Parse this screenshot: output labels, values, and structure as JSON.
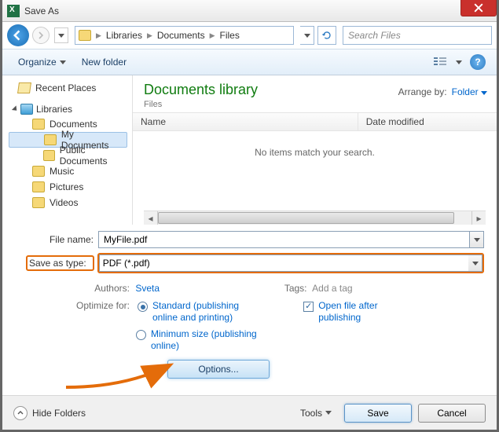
{
  "window": {
    "title": "Save As"
  },
  "breadcrumb": {
    "root": "Libraries",
    "mid": "Documents",
    "leaf": "Files"
  },
  "search": {
    "placeholder": "Search Files"
  },
  "toolbar": {
    "organize": "Organize",
    "newfolder": "New folder"
  },
  "tree": {
    "recent": "Recent Places",
    "libraries": "Libraries",
    "documents": "Documents",
    "mydocs": "My Documents",
    "pubdocs": "Public Documents",
    "music": "Music",
    "pictures": "Pictures",
    "videos": "Videos"
  },
  "content": {
    "heading": "Documents library",
    "sub": "Files",
    "arrange_label": "Arrange by:",
    "arrange_value": "Folder",
    "col_name": "Name",
    "col_date": "Date modified",
    "empty": "No items match your search."
  },
  "form": {
    "filename_label": "File name:",
    "filename_value": "MyFile.pdf",
    "type_label": "Save as type:",
    "type_value": "PDF (*.pdf)",
    "authors_label": "Authors:",
    "authors_value": "Sveta",
    "tags_label": "Tags:",
    "tags_value": "Add a tag",
    "optimize_label": "Optimize for:",
    "opt_standard": "Standard (publishing online and printing)",
    "opt_min": "Minimum size (publishing online)",
    "open_after": "Open file after publishing",
    "options_btn": "Options..."
  },
  "footer": {
    "hide": "Hide Folders",
    "tools": "Tools",
    "save": "Save",
    "cancel": "Cancel"
  }
}
